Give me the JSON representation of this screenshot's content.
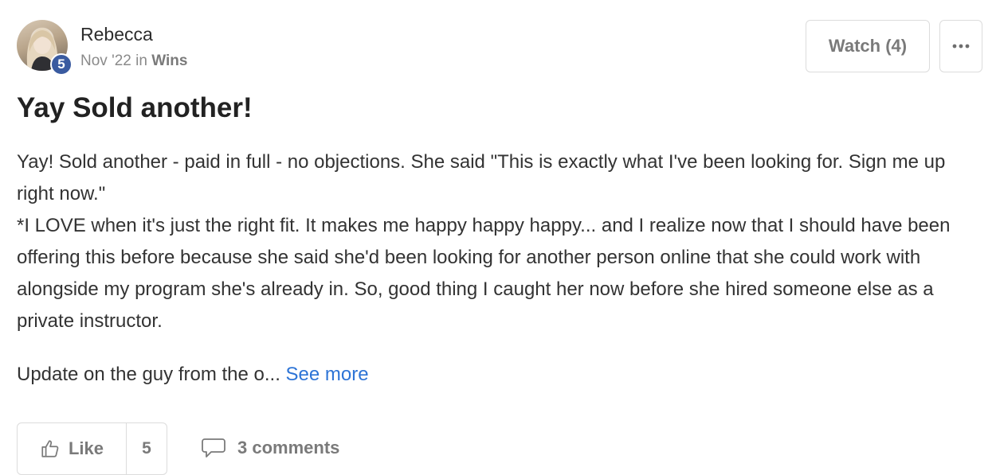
{
  "post": {
    "author": {
      "name": "Rebecca",
      "level": "5",
      "avatar_icon": "user-avatar"
    },
    "meta": {
      "date": "Nov '22",
      "in_word": " in ",
      "category": "Wins"
    },
    "actions": {
      "watch_label": "Watch (4)",
      "more_icon": "ellipsis-icon"
    },
    "title": "Yay Sold another!",
    "body_lines": [
      "Yay! Sold another - paid in full - no objections. She said \"This is exactly what I've been looking for. Sign me up right now.\"",
      "*I LOVE when it's just the right fit. It makes me happy happy happy... and I realize now that I should have been offering this before because she said she'd been looking for another person online that she could work with alongside my program she's already in. So, good thing I caught her now before she hired someone else as a private instructor."
    ],
    "preview_truncated": "Update on the guy from the o... ",
    "see_more_label": "See more",
    "footer": {
      "like_label": "Like",
      "like_count": "5",
      "comments_label": "3 comments"
    }
  },
  "colors": {
    "badge": "#3a5ba0",
    "link": "#2d74d6",
    "muted": "#7a7a7a",
    "border": "#dcdcdc"
  }
}
